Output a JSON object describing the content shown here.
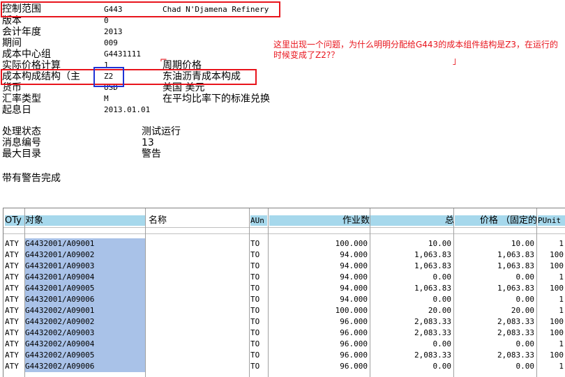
{
  "header": {
    "fields": [
      {
        "label": "控制范围",
        "value": "G443",
        "desc": "Chad N'Djamena Refinery"
      },
      {
        "label": "版本",
        "value": "0",
        "desc": ""
      },
      {
        "label": "会计年度",
        "value": "2013",
        "desc": ""
      },
      {
        "label": "期间",
        "value": "009",
        "desc": ""
      },
      {
        "label": "成本中心组",
        "value": "G4431111",
        "desc": ""
      },
      {
        "label": "实际价格计算",
        "value": "1",
        "desc": "周期价格"
      },
      {
        "label": "成本构成结构（主",
        "value": "Z2",
        "desc": "东油沥青成本构成"
      },
      {
        "label": "货币",
        "value": "USD",
        "desc": "美国 美元"
      },
      {
        "label": "汇率类型",
        "value": "M",
        "desc": "在平均比率下的标准兑换"
      },
      {
        "label": "起息日",
        "value": "2013.01.01",
        "desc": ""
      }
    ]
  },
  "annotation": {
    "text": "这里出现一个问题，为什么明明分配给G443的成本组件结构是Z3，在运行的时候变成了Z2?？"
  },
  "status": {
    "items": [
      {
        "label": "处理状态",
        "value": "测试运行"
      },
      {
        "label": "消息编号",
        "value": "13"
      },
      {
        "label": "最大目录",
        "value": "警告"
      }
    ],
    "complete_text": "带有警告完成"
  },
  "table": {
    "columns": {
      "oty": "OTy",
      "object": "对象",
      "name": "名称",
      "aun": "AUn",
      "activity": "作业数",
      "total": "总",
      "price": "价格 （固定的",
      "punit": "PUnit"
    },
    "rows": [
      {
        "oty": "ATY",
        "object": "G4432001/A09001",
        "name": "",
        "aun": "TO",
        "activity": "100.000",
        "total": "10.00",
        "price": "10.00",
        "punit": "1"
      },
      {
        "oty": "ATY",
        "object": "G4432001/A09002",
        "name": "",
        "aun": "TO",
        "activity": "94.000",
        "total": "1,063.83",
        "price": "1,063.83",
        "punit": "100"
      },
      {
        "oty": "ATY",
        "object": "G4432001/A09003",
        "name": "",
        "aun": "TO",
        "activity": "94.000",
        "total": "1,063.83",
        "price": "1,063.83",
        "punit": "100"
      },
      {
        "oty": "ATY",
        "object": "G4432001/A09004",
        "name": "",
        "aun": "TO",
        "activity": "94.000",
        "total": "0.00",
        "price": "0.00",
        "punit": "1"
      },
      {
        "oty": "ATY",
        "object": "G4432001/A09005",
        "name": "",
        "aun": "TO",
        "activity": "94.000",
        "total": "1,063.83",
        "price": "1,063.83",
        "punit": "100"
      },
      {
        "oty": "ATY",
        "object": "G4432001/A09006",
        "name": "",
        "aun": "TO",
        "activity": "94.000",
        "total": "0.00",
        "price": "0.00",
        "punit": "1"
      },
      {
        "oty": "ATY",
        "object": "G4432002/A09001",
        "name": "",
        "aun": "TO",
        "activity": "100.000",
        "total": "20.00",
        "price": "20.00",
        "punit": "1"
      },
      {
        "oty": "ATY",
        "object": "G4432002/A09002",
        "name": "",
        "aun": "TO",
        "activity": "96.000",
        "total": "2,083.33",
        "price": "2,083.33",
        "punit": "100"
      },
      {
        "oty": "ATY",
        "object": "G4432002/A09003",
        "name": "",
        "aun": "TO",
        "activity": "96.000",
        "total": "2,083.33",
        "price": "2,083.33",
        "punit": "100"
      },
      {
        "oty": "ATY",
        "object": "G4432002/A09004",
        "name": "",
        "aun": "TO",
        "activity": "96.000",
        "total": "0.00",
        "price": "0.00",
        "punit": "1"
      },
      {
        "oty": "ATY",
        "object": "G4432002/A09005",
        "name": "",
        "aun": "TO",
        "activity": "96.000",
        "total": "2,083.33",
        "price": "2,083.33",
        "punit": "100"
      },
      {
        "oty": "ATY",
        "object": "G4432002/A09006",
        "name": "",
        "aun": "TO",
        "activity": "96.000",
        "total": "0.00",
        "price": "0.00",
        "punit": "1"
      }
    ]
  },
  "colors": {
    "highlight_red": "#e8141c",
    "highlight_blue": "#1f34d6",
    "column_header": "#a6d8ec",
    "object_cell": "#a9c2e8"
  }
}
